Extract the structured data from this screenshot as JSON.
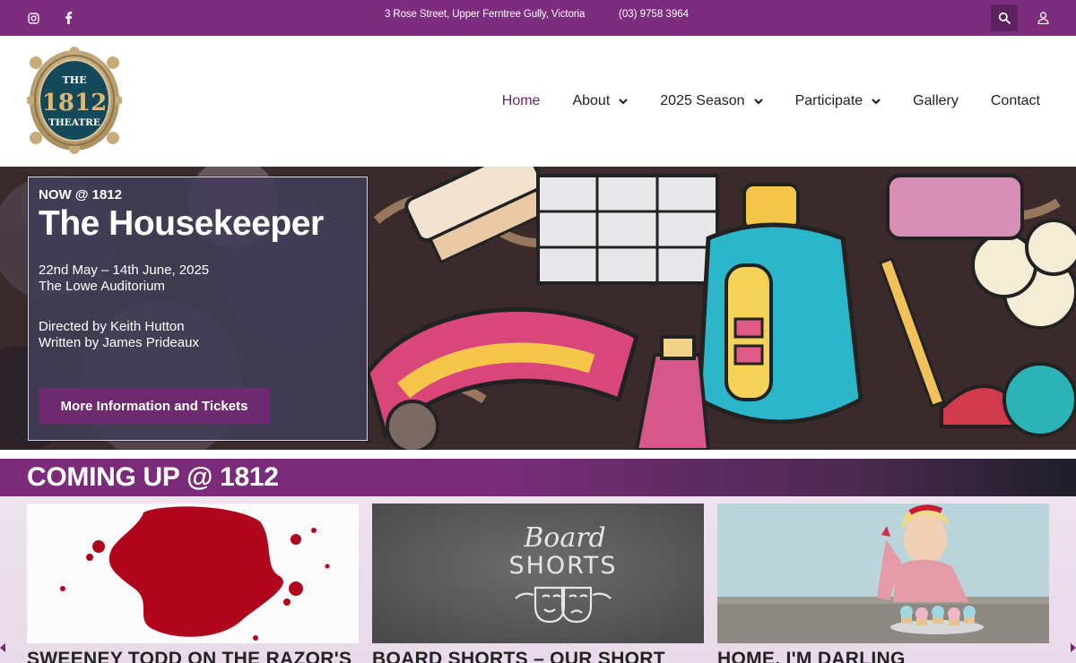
{
  "topbar": {
    "address": "3 Rose Street, Upper Ferntree Gully, Victoria",
    "phone": "(03) 9758 3964",
    "social": [
      "instagram-icon",
      "facebook-icon"
    ],
    "search_icon": "search-icon",
    "user_icon": "user-icon"
  },
  "logo": {
    "line1": "THE",
    "line2": "1812",
    "line3": "THEATRE"
  },
  "nav": {
    "items": [
      {
        "label": "Home",
        "active": true,
        "dropdown": false
      },
      {
        "label": "About",
        "active": false,
        "dropdown": true
      },
      {
        "label": "2025 Season",
        "active": false,
        "dropdown": true
      },
      {
        "label": "Participate",
        "active": false,
        "dropdown": true
      },
      {
        "label": "Gallery",
        "active": false,
        "dropdown": false
      },
      {
        "label": "Contact",
        "active": false,
        "dropdown": false
      }
    ]
  },
  "hero": {
    "eyebrow": "NOW @ 1812",
    "title": "The Housekeeper",
    "dates": "22nd May – 14th June, 2025",
    "venue": "The Lowe Auditorium",
    "director": "Directed by Keith Hutton",
    "writer": "Written by James Prideaux",
    "cta_label": "More Information and Tickets"
  },
  "coming_up": {
    "heading": "COMING UP @ 1812",
    "cards": [
      {
        "caption": "SWEENEY TODD ON THE RAZOR'S",
        "image_text_1": "",
        "image_text_2": ""
      },
      {
        "caption": "BOARD SHORTS – OUR SHORT",
        "image_text_1": "Board",
        "image_text_2": "SHORTS"
      },
      {
        "caption": "HOME, I'M DARLING",
        "image_text_1": "",
        "image_text_2": ""
      }
    ]
  },
  "colors": {
    "brand_purple": "#7d2d7e",
    "button_purple": "#6e2a6f",
    "nav_active": "#6d2570"
  }
}
